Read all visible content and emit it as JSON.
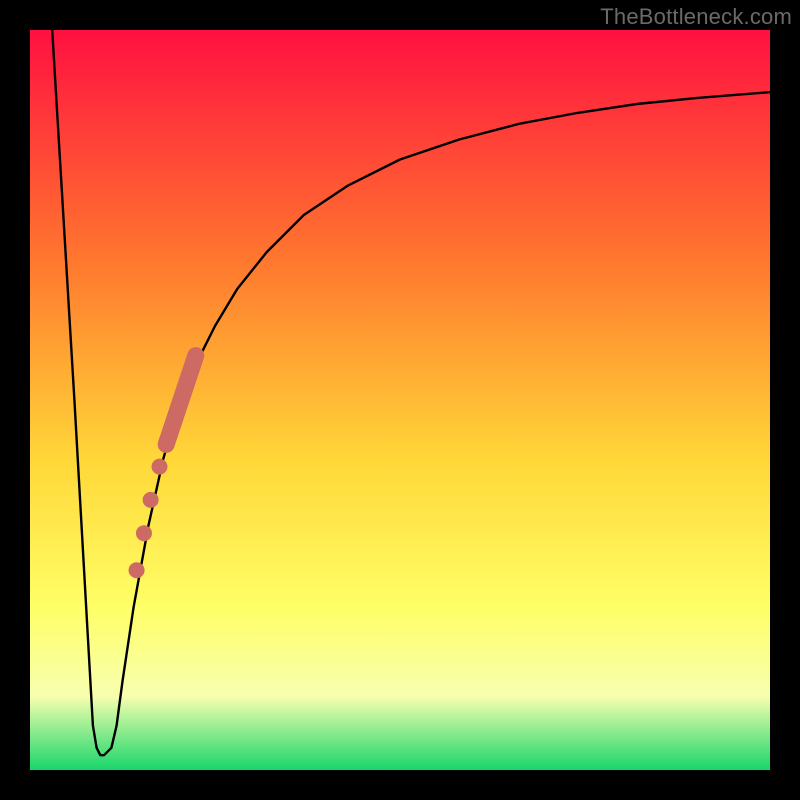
{
  "watermark": "TheBottleneck.com",
  "colors": {
    "gradient_top": "#ff1040",
    "gradient_mid_upper": "#ff7a2e",
    "gradient_mid": "#ffd738",
    "gradient_mid_lower": "#ffff66",
    "gradient_lower": "#f7ffb0",
    "gradient_bottom": "#18d66a",
    "curve": "#000000",
    "marker": "#cc6a63",
    "frame": "#000000"
  },
  "chart_data": {
    "type": "line",
    "title": "",
    "xlabel": "",
    "ylabel": "",
    "xlim": [
      0,
      100
    ],
    "ylim": [
      0,
      100
    ],
    "grid": false,
    "legend": false,
    "series": [
      {
        "name": "curve",
        "x": [
          3,
          6,
          8.5,
          9,
          9.5,
          10,
          11,
          11.7,
          12.5,
          14,
          16,
          18,
          20,
          22.5,
          25,
          28,
          32,
          37,
          43,
          50,
          58,
          66,
          74,
          82,
          90,
          100
        ],
        "y": [
          100,
          50,
          6,
          3,
          2,
          2,
          3,
          6,
          12,
          22,
          33,
          42,
          49,
          55,
          60,
          65,
          70,
          75,
          79,
          82.5,
          85.2,
          87.3,
          88.8,
          90,
          90.8,
          91.6
        ]
      }
    ],
    "markers": {
      "name": "highlight-segment",
      "stroke_start": {
        "x": 18.4,
        "y": 44
      },
      "stroke_end": {
        "x": 22.4,
        "y": 56
      },
      "dots": [
        {
          "x": 17.5,
          "y": 41
        },
        {
          "x": 16.3,
          "y": 36.5
        },
        {
          "x": 15.4,
          "y": 32
        },
        {
          "x": 14.4,
          "y": 27
        }
      ]
    }
  }
}
